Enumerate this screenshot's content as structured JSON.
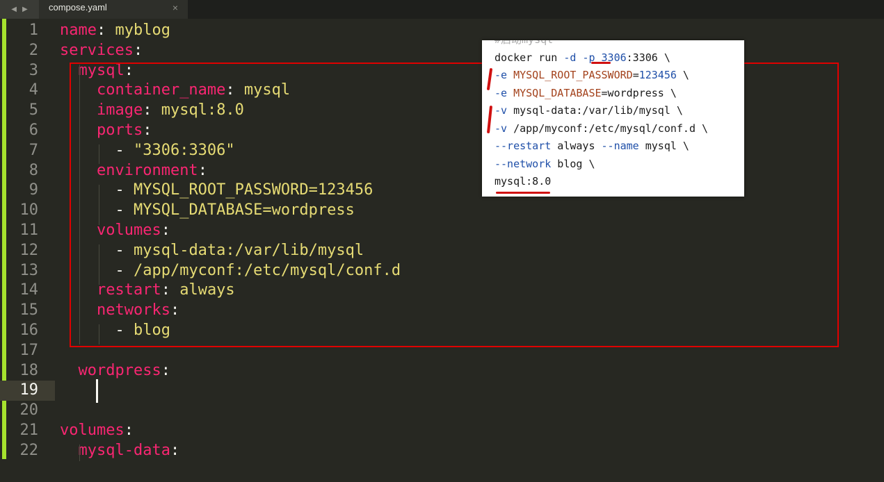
{
  "tabbar": {
    "nav_back": "◀",
    "nav_forward": "▶",
    "tab_label": "compose.yaml",
    "tab_close": "×"
  },
  "editor": {
    "lines": [
      {
        "num": "1",
        "tokens": [
          [
            "k",
            "name"
          ],
          [
            "p",
            ": "
          ],
          [
            "v",
            "myblog"
          ]
        ]
      },
      {
        "num": "2",
        "tokens": [
          [
            "k",
            "services"
          ],
          [
            "p",
            ":"
          ]
        ]
      },
      {
        "num": "3",
        "tokens": [
          [
            "p",
            "  "
          ],
          [
            "k",
            "mysql"
          ],
          [
            "p",
            ":"
          ]
        ]
      },
      {
        "num": "4",
        "tokens": [
          [
            "p",
            "    "
          ],
          [
            "k",
            "container_name"
          ],
          [
            "p",
            ": "
          ],
          [
            "v",
            "mysql"
          ]
        ]
      },
      {
        "num": "5",
        "tokens": [
          [
            "p",
            "    "
          ],
          [
            "k",
            "image"
          ],
          [
            "p",
            ": "
          ],
          [
            "v",
            "mysql:8.0"
          ]
        ]
      },
      {
        "num": "6",
        "tokens": [
          [
            "p",
            "    "
          ],
          [
            "k",
            "ports"
          ],
          [
            "p",
            ":"
          ]
        ]
      },
      {
        "num": "7",
        "tokens": [
          [
            "p",
            "      - "
          ],
          [
            "v",
            "\"3306:3306\""
          ]
        ]
      },
      {
        "num": "8",
        "tokens": [
          [
            "p",
            "    "
          ],
          [
            "k",
            "environment"
          ],
          [
            "p",
            ":"
          ]
        ]
      },
      {
        "num": "9",
        "tokens": [
          [
            "p",
            "      - "
          ],
          [
            "v",
            "MYSQL_ROOT_PASSWORD=123456"
          ]
        ]
      },
      {
        "num": "10",
        "tokens": [
          [
            "p",
            "      - "
          ],
          [
            "v",
            "MYSQL_DATABASE=wordpress"
          ]
        ]
      },
      {
        "num": "11",
        "tokens": [
          [
            "p",
            "    "
          ],
          [
            "k",
            "volumes"
          ],
          [
            "p",
            ":"
          ]
        ]
      },
      {
        "num": "12",
        "tokens": [
          [
            "p",
            "      - "
          ],
          [
            "v",
            "mysql-data:/var/lib/mysql"
          ]
        ]
      },
      {
        "num": "13",
        "tokens": [
          [
            "p",
            "      - "
          ],
          [
            "v",
            "/app/myconf:/etc/mysql/conf.d"
          ]
        ]
      },
      {
        "num": "14",
        "tokens": [
          [
            "p",
            "    "
          ],
          [
            "k",
            "restart"
          ],
          [
            "p",
            ": "
          ],
          [
            "v",
            "always"
          ]
        ]
      },
      {
        "num": "15",
        "tokens": [
          [
            "p",
            "    "
          ],
          [
            "k",
            "networks"
          ],
          [
            "p",
            ":"
          ]
        ]
      },
      {
        "num": "16",
        "tokens": [
          [
            "p",
            "      - "
          ],
          [
            "v",
            "blog"
          ]
        ]
      },
      {
        "num": "17",
        "tokens": []
      },
      {
        "num": "18",
        "tokens": [
          [
            "p",
            "  "
          ],
          [
            "k",
            "wordpress"
          ],
          [
            "p",
            ":"
          ]
        ]
      },
      {
        "num": "19",
        "tokens": [],
        "active": true
      },
      {
        "num": "20",
        "tokens": []
      },
      {
        "num": "21",
        "tokens": [
          [
            "k",
            "volumes"
          ],
          [
            "p",
            ":"
          ]
        ]
      },
      {
        "num": "22",
        "tokens": [
          [
            "p",
            "  "
          ],
          [
            "k",
            "mysql-data"
          ],
          [
            "p",
            ":"
          ]
        ]
      }
    ]
  },
  "snippet": {
    "lines": [
      [
        [
          "c",
          "#启动mysql"
        ]
      ],
      [
        [
          "t",
          "docker run "
        ],
        [
          "o",
          "-d"
        ],
        [
          "t",
          " "
        ],
        [
          "o",
          "-p"
        ],
        [
          "t",
          " "
        ],
        [
          "n",
          "3306"
        ],
        [
          "t",
          ":3306 \\"
        ]
      ],
      [
        [
          "o",
          "-e"
        ],
        [
          "t",
          " "
        ],
        [
          "s",
          "MYSQL_ROOT_PASSWORD"
        ],
        [
          "t",
          "="
        ],
        [
          "n",
          "123456"
        ],
        [
          "t",
          " \\"
        ]
      ],
      [
        [
          "o",
          "-e"
        ],
        [
          "t",
          " "
        ],
        [
          "s",
          "MYSQL_DATABASE"
        ],
        [
          "t",
          "=wordpress \\"
        ]
      ],
      [
        [
          "o",
          "-v"
        ],
        [
          "t",
          " mysql-data:/var/lib/mysql \\"
        ]
      ],
      [
        [
          "o",
          "-v"
        ],
        [
          "t",
          " /app/myconf:/etc/mysql/conf.d \\"
        ]
      ],
      [
        [
          "o",
          "--restart"
        ],
        [
          "t",
          " always "
        ],
        [
          "o",
          "--name"
        ],
        [
          "t",
          " mysql \\"
        ]
      ],
      [
        [
          "o",
          "--network"
        ],
        [
          "t",
          " blog \\"
        ]
      ],
      [
        [
          "t",
          "mysql:8.0"
        ]
      ]
    ]
  },
  "colors": {
    "background": "#272822",
    "key": "#f92672",
    "value": "#e6db74",
    "annotation_red": "#e00000"
  }
}
